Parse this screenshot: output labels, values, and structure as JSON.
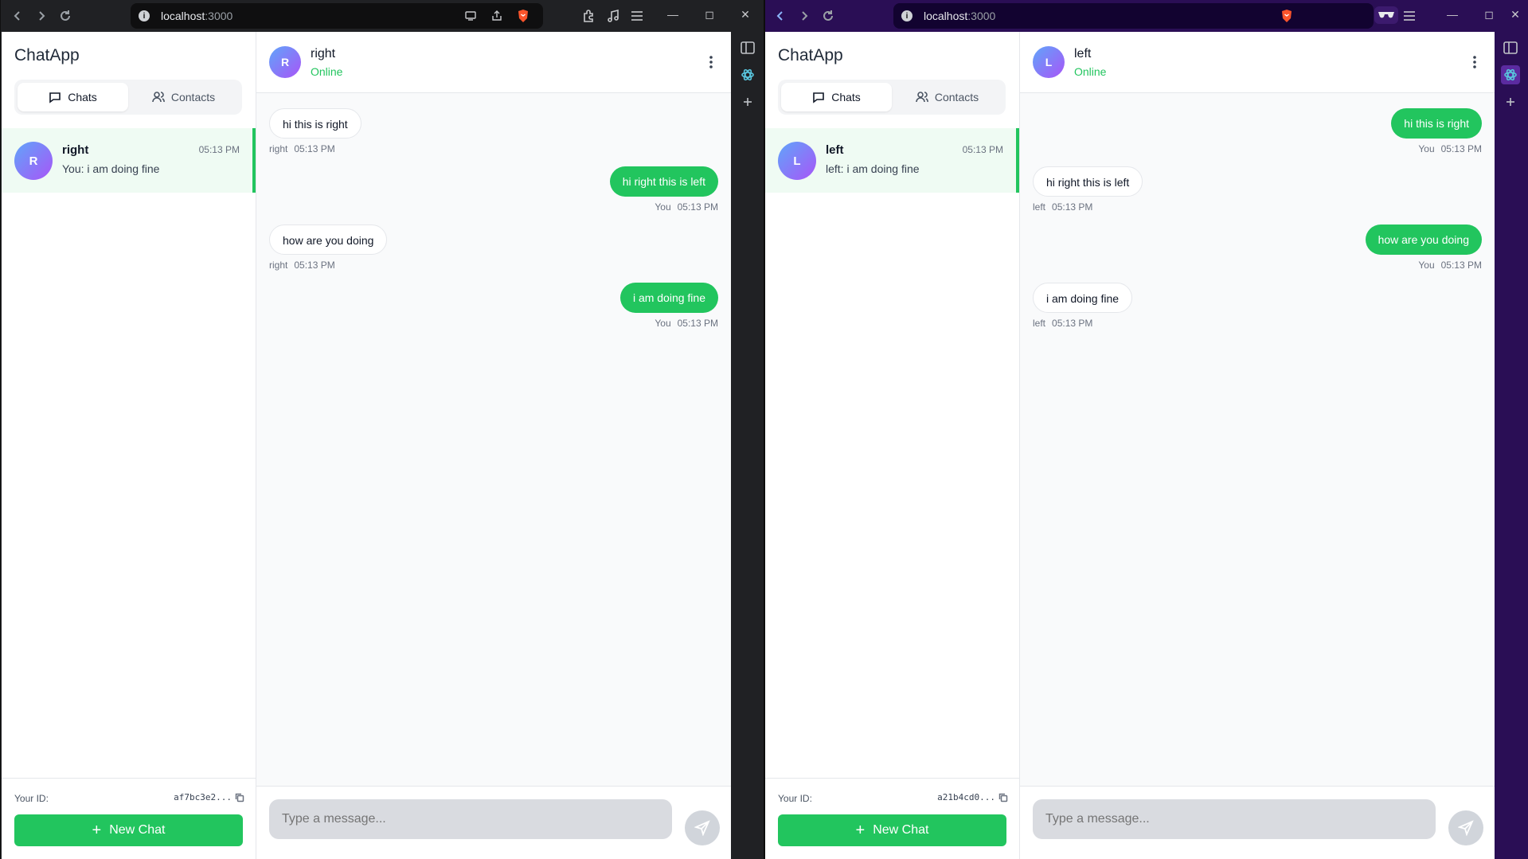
{
  "windows": [
    {
      "browser": {
        "url_host": "localhost",
        "url_port": ":3000"
      },
      "app": {
        "brand": "ChatApp",
        "tabs": {
          "chats": "Chats",
          "contacts": "Contacts"
        },
        "conversation": {
          "avatar": "R",
          "name": "right",
          "time": "05:13 PM",
          "preview": "You: i am doing fine"
        },
        "your_id_label": "Your ID:",
        "your_id_value": "af7bc3e2...",
        "new_chat_label": "New Chat",
        "header": {
          "avatar": "R",
          "name": "right",
          "status": "Online"
        },
        "messages": [
          {
            "dir": "in",
            "text": "hi this is right",
            "sender": "right",
            "time": "05:13 PM"
          },
          {
            "dir": "out",
            "text": "hi right this is left",
            "sender": "You",
            "time": "05:13 PM"
          },
          {
            "dir": "in",
            "text": "how are you doing",
            "sender": "right",
            "time": "05:13 PM"
          },
          {
            "dir": "out",
            "text": "i am doing fine",
            "sender": "You",
            "time": "05:13 PM"
          }
        ],
        "composer_placeholder": "Type a message..."
      }
    },
    {
      "browser": {
        "url_host": "localhost",
        "url_port": ":3000"
      },
      "app": {
        "brand": "ChatApp",
        "tabs": {
          "chats": "Chats",
          "contacts": "Contacts"
        },
        "conversation": {
          "avatar": "L",
          "name": "left",
          "time": "05:13 PM",
          "preview": "left: i am doing fine"
        },
        "your_id_label": "Your ID:",
        "your_id_value": "a21b4cd0...",
        "new_chat_label": "New Chat",
        "header": {
          "avatar": "L",
          "name": "left",
          "status": "Online"
        },
        "messages": [
          {
            "dir": "out",
            "text": "hi this is right",
            "sender": "You",
            "time": "05:13 PM"
          },
          {
            "dir": "in",
            "text": "hi right this is left",
            "sender": "left",
            "time": "05:13 PM"
          },
          {
            "dir": "out",
            "text": "how are you doing",
            "sender": "You",
            "time": "05:13 PM"
          },
          {
            "dir": "in",
            "text": "i am doing fine",
            "sender": "left",
            "time": "05:13 PM"
          }
        ],
        "composer_placeholder": "Type a message..."
      }
    }
  ],
  "colors": {
    "accent": "#22c55e",
    "online": "#22c55e",
    "selected_row": "#effbf3"
  }
}
